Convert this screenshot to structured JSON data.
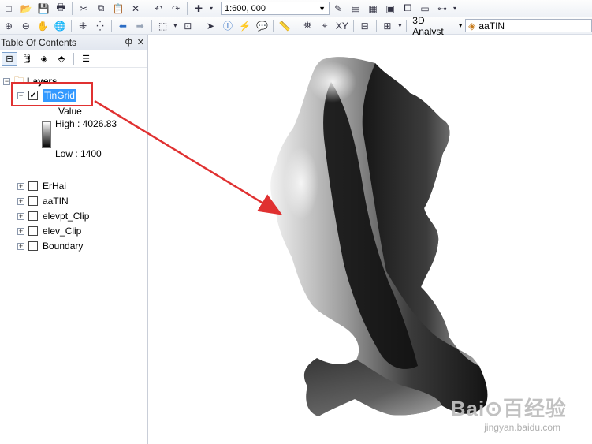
{
  "toolbar1": {
    "scale_value": "1:600, 000"
  },
  "toolbar2": {
    "analyst_menu": "3D Analyst",
    "layer_select": "aaTIN"
  },
  "toc": {
    "title": "Table Of Contents",
    "pin": "ф",
    "close": "✕",
    "root_label": "Layers",
    "active_layer": {
      "name": "TinGrid",
      "checked": true,
      "legend_title": "Value",
      "high_label": "High : 4026.83",
      "low_label": "Low : 1400"
    },
    "other_layers": [
      {
        "name": "ErHai",
        "checked": false
      },
      {
        "name": "aaTIN",
        "checked": false
      },
      {
        "name": "elevpt_Clip",
        "checked": false
      },
      {
        "name": "elev_Clip",
        "checked": false
      },
      {
        "name": "Boundary",
        "checked": false
      }
    ]
  },
  "annotation_color": "#e03131",
  "watermark": {
    "brand": "Bai⊙百经验",
    "url": "jingyan.baidu.com"
  }
}
